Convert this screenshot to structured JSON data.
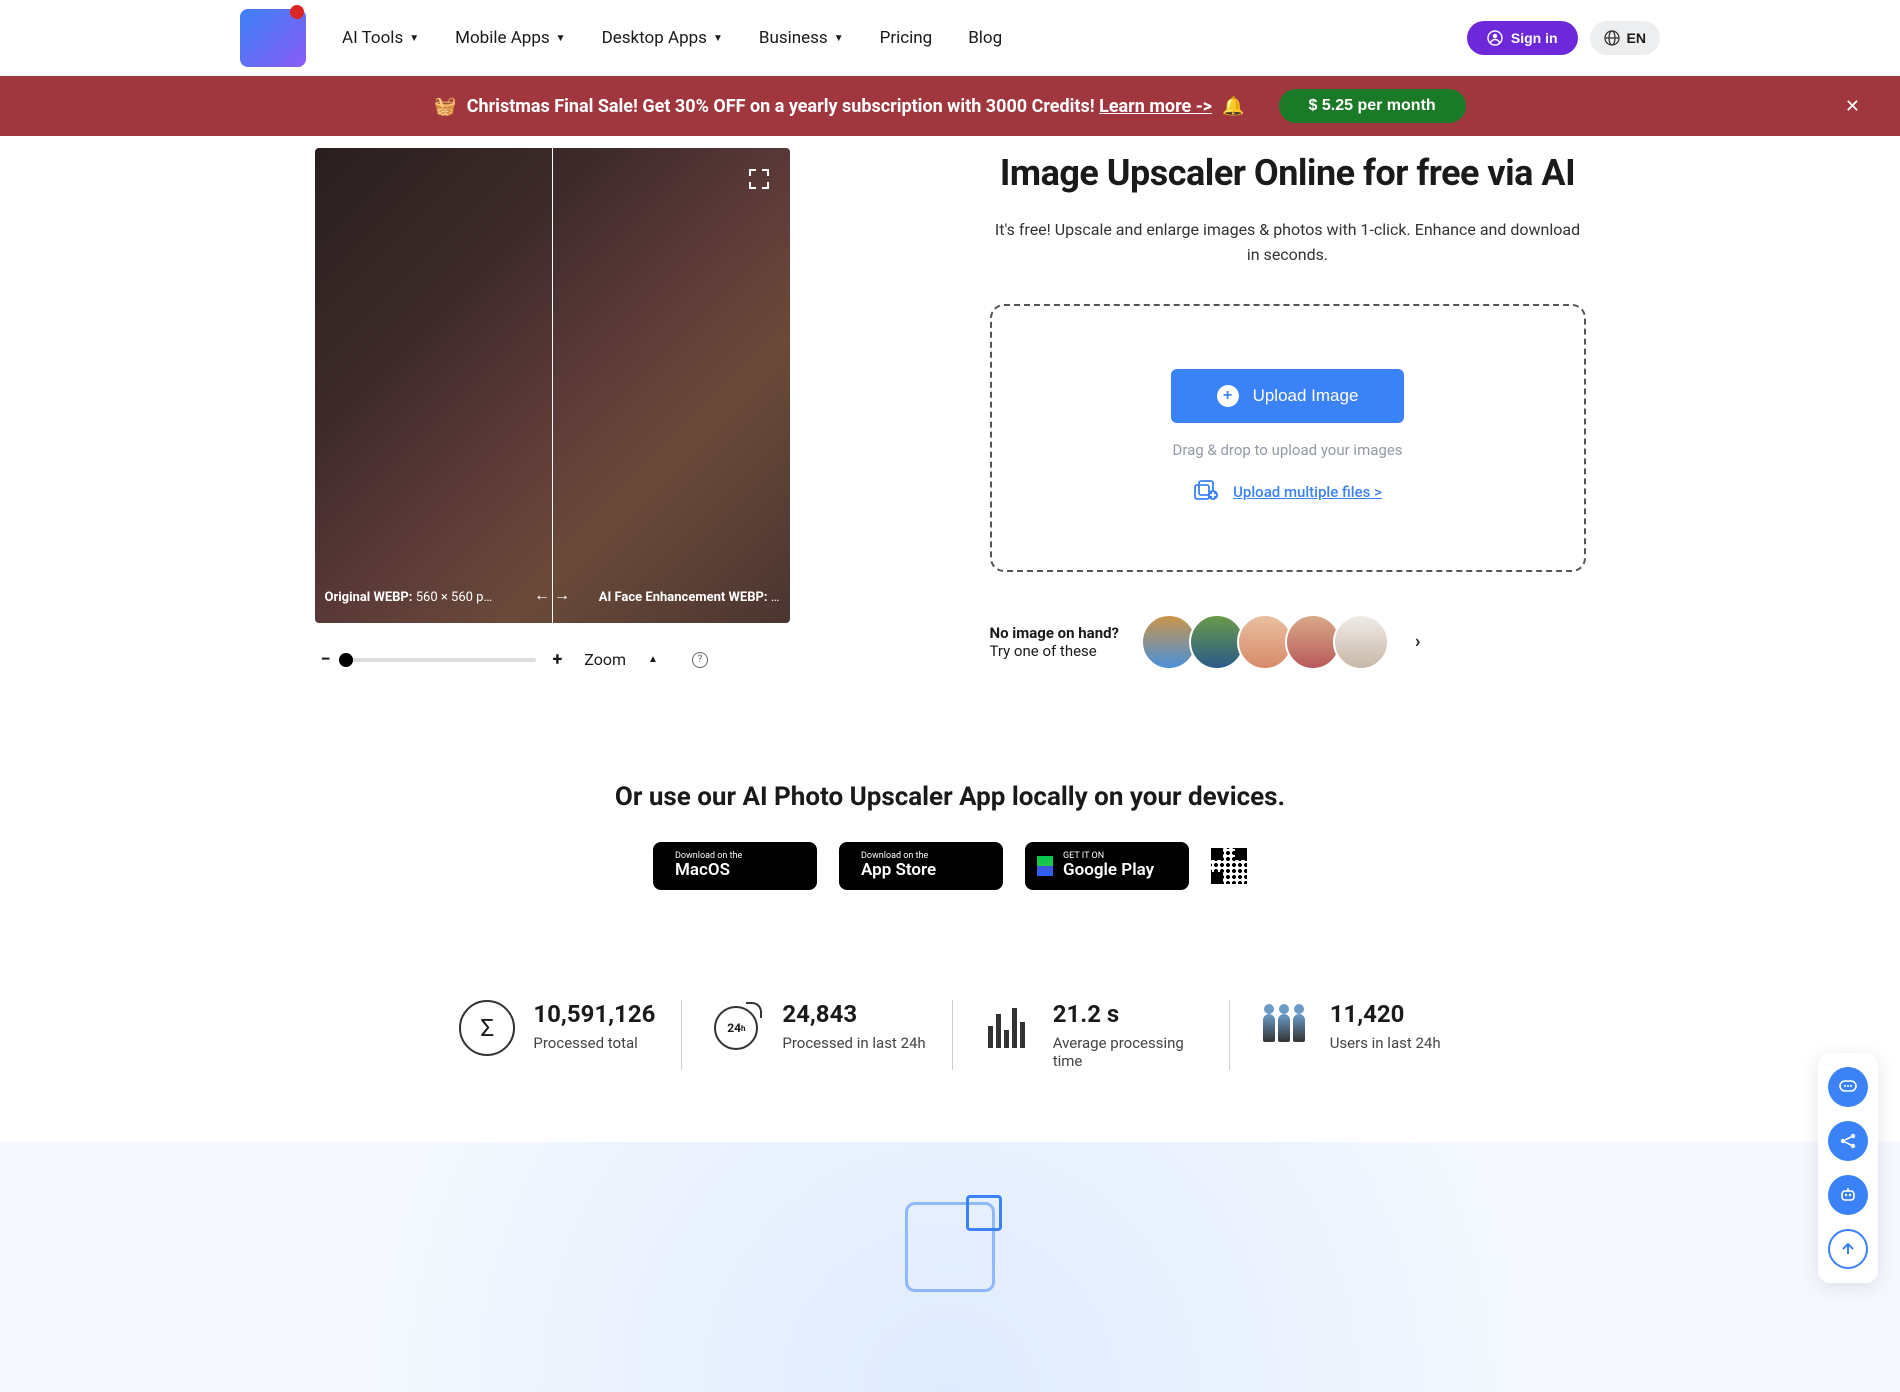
{
  "nav": {
    "ai_tools": "AI Tools",
    "mobile": "Mobile Apps",
    "desktop": "Desktop Apps",
    "business": "Business",
    "pricing": "Pricing",
    "blog": "Blog"
  },
  "signin": "Sign in",
  "lang": "EN",
  "banner": {
    "text": "Christmas Final Sale! Get 30% OFF on a yearly subscription with 3000 Credits!",
    "learn": "Learn more ->",
    "price": "$ 5.25 per month"
  },
  "hero": {
    "title": "Image Upscaler Online for free via AI",
    "subtitle": "It's free! Upscale and enlarge images & photos with 1-click. Enhance and download in seconds."
  },
  "compare": {
    "left_label": "Original WEBP:",
    "left_dims": "560 × 560 p…",
    "right_label": "AI Face Enhancement WEBP:",
    "right_dims": "…"
  },
  "zoom": {
    "label": "Zoom"
  },
  "upload": {
    "button": "Upload Image",
    "hint": "Drag & drop to upload your images",
    "multi": "Upload multiple files >"
  },
  "samples": {
    "line1": "No image on hand?",
    "line2": "Try one of these"
  },
  "apps": {
    "title": "Or use our AI Photo Upscaler App locally on your devices.",
    "mac_s": "Download on the",
    "mac_b": "MacOS",
    "ios_s": "Download on the",
    "ios_b": "App Store",
    "gp_s": "GET IT ON",
    "gp_b": "Google Play"
  },
  "stats": {
    "s1_v": "10,591,126",
    "s1_l": "Processed total",
    "s2_v": "24,843",
    "s2_l": "Processed in last 24h",
    "s3_v": "21.2 s",
    "s3_l": "Average processing time",
    "s4_v": "11,420",
    "s4_l": "Users in last 24h"
  }
}
